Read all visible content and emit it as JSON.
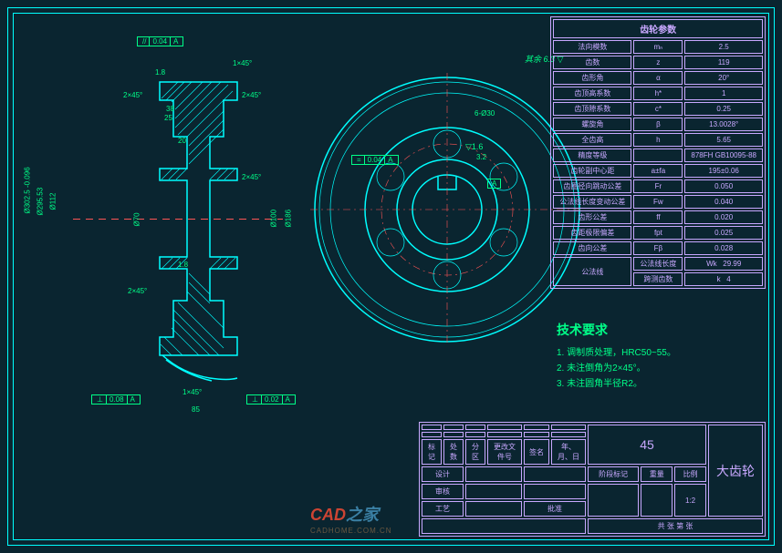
{
  "gear_params": {
    "title": "齿轮参数",
    "rows": [
      {
        "label": "法向模数",
        "sym": "mₙ",
        "val": "2.5"
      },
      {
        "label": "齿数",
        "sym": "z",
        "val": "119"
      },
      {
        "label": "齿形角",
        "sym": "α",
        "val": "20°"
      },
      {
        "label": "齿顶高系数",
        "sym": "h*",
        "val": "1"
      },
      {
        "label": "齿顶隙系数",
        "sym": "c*",
        "val": "0.25"
      },
      {
        "label": "螺旋角",
        "sym": "β",
        "val": "13.0028°"
      },
      {
        "label": "全齿高",
        "sym": "h",
        "val": "5.65"
      },
      {
        "label": "精度等级",
        "sym": "",
        "val": "878FH GB10095-88"
      },
      {
        "label": "齿轮副中心距",
        "sym": "a±fa",
        "val": "195±0.06"
      },
      {
        "label": "齿圈径向跳动公差",
        "sym": "Fr",
        "val": "0.050"
      },
      {
        "label": "公法线长度变动公差",
        "sym": "Fw",
        "val": "0.040"
      },
      {
        "label": "齿形公差",
        "sym": "ff",
        "val": "0.020"
      },
      {
        "label": "齿距极限偏差",
        "sym": "fpt",
        "val": "0.025"
      },
      {
        "label": "齿向公差",
        "sym": "Fβ",
        "val": "0.028"
      }
    ],
    "spanrows": {
      "label": "公法线",
      "r1": {
        "label": "公法线长度",
        "sym": "Wk",
        "val": "29.99"
      },
      "r2": {
        "label": "跨测齿数",
        "sym": "k",
        "val": "4"
      }
    }
  },
  "tech_req": {
    "title": "技术要求",
    "items": [
      "1. 调制质处理，HRC50~55。",
      "2. 未注倒角为2×45°。",
      "3. 未注圆角半径R2。"
    ]
  },
  "dimensions": {
    "d1": "Ø302.5 -0.096",
    "d2": "Ø295.53",
    "d3": "Ø112",
    "d4": "Ø70",
    "d5": "Ø100",
    "d6": "Ø186",
    "bolt": "6-Ø30",
    "w1": "85",
    "w2": "20",
    "w3": "38",
    "k1": "1.8",
    "k2": "1.8",
    "k3": "3.2",
    "key": "25",
    "c1": "2×45°",
    "c2": "2×45°",
    "c3": "1×45°",
    "c4": "1×45°",
    "c5": "2×45°"
  },
  "gdt": {
    "t1": {
      "sym": "//",
      "tol": "0.04",
      "ref": "A"
    },
    "t2": {
      "sym": "⊥",
      "tol": "0.08",
      "ref": "A"
    },
    "t3": {
      "sym": "⊥",
      "tol": "0.02",
      "ref": "A"
    },
    "t4": {
      "sym": "=",
      "tol": "0.04",
      "ref": "A"
    },
    "datum": "A"
  },
  "roughness": {
    "default": "其余 6.3",
    "r1": "1.6"
  },
  "title_block": {
    "material": "45",
    "part_name": "大齿轮",
    "scale_label": "比例",
    "scale": "1:2",
    "stage_label": "阶段标记",
    "weight_label": "重量",
    "sheet": "共    张    第    张",
    "cols": [
      "标记",
      "处数",
      "分区",
      "更改文件号",
      "签名",
      "年、月、日"
    ],
    "rows": [
      "设计",
      "审核",
      "工艺",
      "批准"
    ]
  },
  "watermark": {
    "p1": "CAD",
    "p2": "之家",
    "sub": "CADHOME.COM.CN"
  }
}
